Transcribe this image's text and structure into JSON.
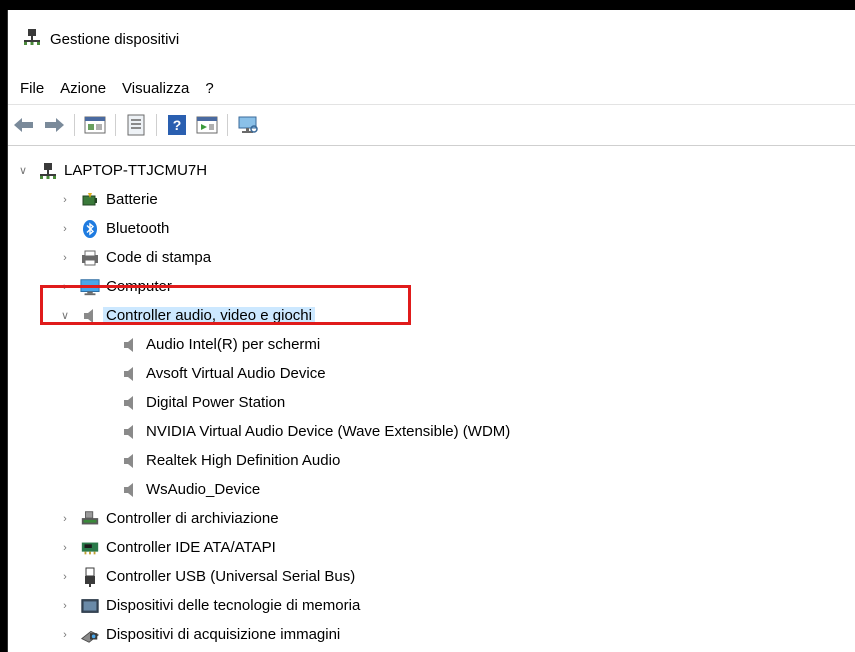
{
  "window": {
    "title": "Gestione dispositivi"
  },
  "menu": {
    "file": "File",
    "action": "Azione",
    "view": "Visualizza",
    "help": "?"
  },
  "toolbar": {
    "icons": [
      "back-icon",
      "forward-icon",
      "properties-icon",
      "show-hidden-icon",
      "help-icon",
      "update-driver-icon",
      "scan-hardware-icon"
    ]
  },
  "tree": {
    "root": "LAPTOP-TTJCMU7H",
    "items": [
      {
        "label": "Batterie",
        "icon": "battery-icon"
      },
      {
        "label": "Bluetooth",
        "icon": "bluetooth-icon"
      },
      {
        "label": "Code di stampa",
        "icon": "print-queue-icon"
      },
      {
        "label": "Computer",
        "icon": "computer-icon"
      },
      {
        "label": "Controller audio, video e giochi",
        "icon": "speaker-icon",
        "expanded": true
      },
      {
        "label": "Audio Intel(R) per schermi",
        "icon": "speaker-icon"
      },
      {
        "label": "Avsoft Virtual Audio Device",
        "icon": "speaker-icon"
      },
      {
        "label": "Digital Power Station",
        "icon": "speaker-icon"
      },
      {
        "label": "NVIDIA Virtual Audio Device (Wave Extensible) (WDM)",
        "icon": "speaker-icon"
      },
      {
        "label": "Realtek High Definition Audio",
        "icon": "speaker-icon"
      },
      {
        "label": "WsAudio_Device",
        "icon": "speaker-icon"
      },
      {
        "label": "Controller di archiviazione",
        "icon": "storage-controller-icon"
      },
      {
        "label": "Controller IDE ATA/ATAPI",
        "icon": "ide-controller-icon"
      },
      {
        "label": "Controller USB (Universal Serial Bus)",
        "icon": "usb-icon"
      },
      {
        "label": "Dispositivi delle tecnologie di memoria",
        "icon": "memory-device-icon"
      },
      {
        "label": "Dispositivi di acquisizione immagini",
        "icon": "imaging-device-icon"
      }
    ]
  },
  "colors": {
    "highlight_box": "#e01b1b",
    "selection": "#cce8ff",
    "bluetooth": "#1e7be0"
  }
}
